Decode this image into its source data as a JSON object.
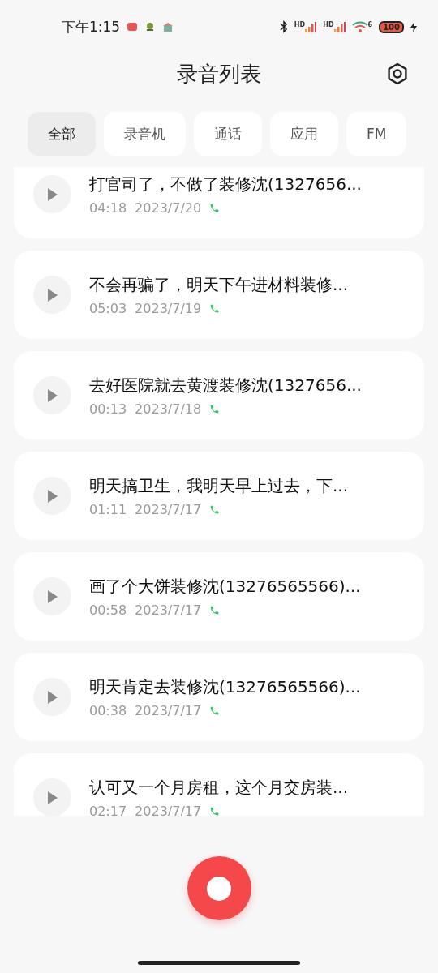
{
  "status_bar": {
    "time": "下午1:15",
    "networks": [
      {
        "label": "HD"
      },
      {
        "label": "HD"
      }
    ],
    "wifi_label": "6",
    "battery": "100"
  },
  "header": {
    "title": "录音列表"
  },
  "tabs": [
    {
      "label": "全部",
      "selected": true
    },
    {
      "label": "录音机",
      "selected": false
    },
    {
      "label": "通话",
      "selected": false
    },
    {
      "label": "应用",
      "selected": false
    },
    {
      "label": "FM",
      "selected": false
    }
  ],
  "recordings": [
    {
      "title": "打官司了，不做了装修沈(1327656...",
      "duration": "04:18",
      "date": "2023/7/20",
      "kind": "call"
    },
    {
      "title": "不会再骗了，明天下午进材料装修...",
      "duration": "05:03",
      "date": "2023/7/19",
      "kind": "call"
    },
    {
      "title": "去好医院就去黄渡装修沈(1327656...",
      "duration": "00:13",
      "date": "2023/7/18",
      "kind": "call"
    },
    {
      "title": "明天搞卫生，我明天早上过去，下...",
      "duration": "01:11",
      "date": "2023/7/17",
      "kind": "call"
    },
    {
      "title": "画了个大饼装修沈(13276565566)...",
      "duration": "00:58",
      "date": "2023/7/17",
      "kind": "call"
    },
    {
      "title": "明天肯定去装修沈(13276565566)...",
      "duration": "00:38",
      "date": "2023/7/17",
      "kind": "call"
    },
    {
      "title": "认可又一个月房租，这个月交房装...",
      "duration": "02:17",
      "date": "2023/7/17",
      "kind": "call"
    }
  ]
}
